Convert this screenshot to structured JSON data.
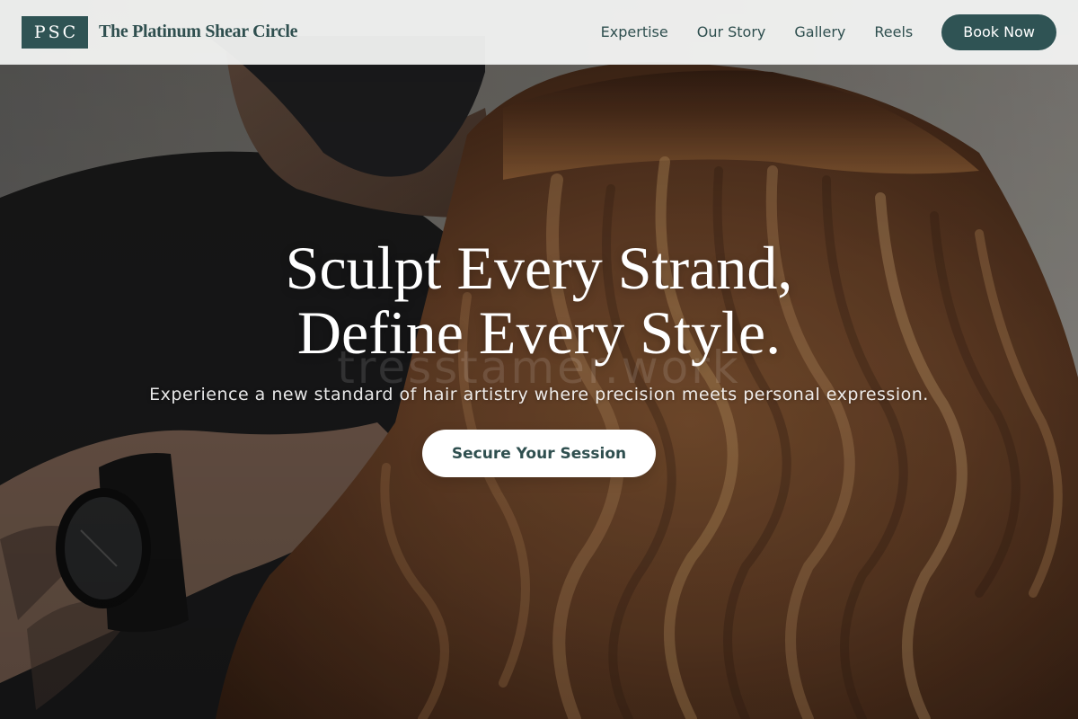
{
  "brand": {
    "mark": "PSC",
    "name": "The Platinum Shear Circle",
    "color": "#2f5354"
  },
  "nav": {
    "links": [
      {
        "label": "Expertise"
      },
      {
        "label": "Our Story"
      },
      {
        "label": "Gallery"
      },
      {
        "label": "Reels"
      }
    ],
    "cta_label": "Book Now"
  },
  "hero": {
    "title_line1": "Sculpt Every Strand,",
    "title_line2": "Define Every Style.",
    "subtitle": "Experience a new standard of hair artistry where precision meets personal expression.",
    "cta_label": "Secure Your Session",
    "watermark": "tresstamer.work",
    "image": "hair-stylist-photo"
  },
  "colors": {
    "accent": "#2f5354",
    "navbar_bg": "#f4f5f4",
    "text_dark": "#2f4f4f"
  }
}
